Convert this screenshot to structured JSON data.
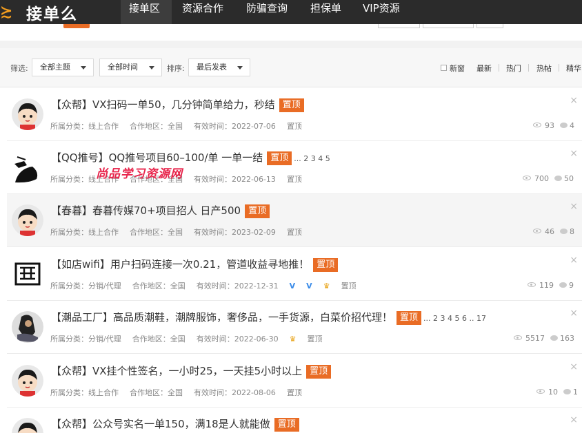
{
  "nav": {
    "logo_text": "接单么",
    "items": [
      {
        "label": "接单区"
      },
      {
        "label": "资源合作"
      },
      {
        "label": "防骗查询"
      },
      {
        "label": "担保单"
      },
      {
        "label": "VIP资源"
      }
    ]
  },
  "filter": {
    "filter_label": "筛选:",
    "theme": "全部主题",
    "time": "全部时间",
    "sort_label": "排序:",
    "sort": "最后发表",
    "new_window": "新窗",
    "latest": "最新",
    "hot": "热门",
    "hot_post": "热帖",
    "featured": "精华"
  },
  "watermark": "尚品学习资源网",
  "posts": [
    {
      "title": "【众帮】VX扫码一单50，几分钟简单给力，秒结",
      "badge": "置顶",
      "pages": "",
      "category": "所属分类：线上合作",
      "region": "合作地区：全国",
      "valid": "有效时间：2022-07-06",
      "pin": "置顶",
      "views": "93",
      "replies": "4",
      "close": "×"
    },
    {
      "title": "【QQ推号】QQ推号项目60–100/单 一单一结",
      "badge": "置顶",
      "pages": "... 2  3  4  5",
      "category": "所属分类：线上合作",
      "region": "合作地区：全国",
      "valid": "有效时间：2022-06-13",
      "pin": "置顶",
      "views": "700",
      "replies": "50",
      "close": "×"
    },
    {
      "title": "【春暮】春暮传媒70+项目招人 日产500",
      "badge": "置顶",
      "pages": "",
      "category": "所属分类：线上合作",
      "region": "合作地区：全国",
      "valid": "有效时间：2023-02-09",
      "pin": "置顶",
      "views": "46",
      "replies": "8",
      "close": "×"
    },
    {
      "title": "【如店wifi】用户扫码连接一次0.21，管道收益寻地推！",
      "badge": "置顶",
      "pages": "",
      "category": "所属分类：分销/代理",
      "region": "合作地区：全国",
      "valid": "有效时间：2022-12-31",
      "pin": "置顶",
      "views": "119",
      "replies": "9",
      "close": "×"
    },
    {
      "title": "【潮品工厂】高品质潮鞋，潮牌服饰，奢侈品，一手货源，白菜价招代理！",
      "badge": "置顶",
      "pages": "... 2  3  4  5  6 .. 17",
      "category": "所属分类：分销/代理",
      "region": "合作地区：全国",
      "valid": "有效时间：2022-06-30",
      "pin": "置顶",
      "views": "5517",
      "replies": "163",
      "close": "×"
    },
    {
      "title": "【众帮】VX挂个性签名，一小时25，一天挂5小时以上",
      "badge": "置顶",
      "pages": "",
      "category": "所属分类：线上合作",
      "region": "合作地区：全国",
      "valid": "有效时间：2022-08-06",
      "pin": "置顶",
      "views": "10",
      "replies": "1",
      "close": "×"
    },
    {
      "title": "【众帮】公众号实名一单150，满18是人就能做",
      "badge": "置顶",
      "pages": "",
      "close": "×"
    }
  ],
  "colors": {
    "nav_bg": "#2b2b2b",
    "accent": "#e96c25",
    "watermark": "#e8244b"
  }
}
